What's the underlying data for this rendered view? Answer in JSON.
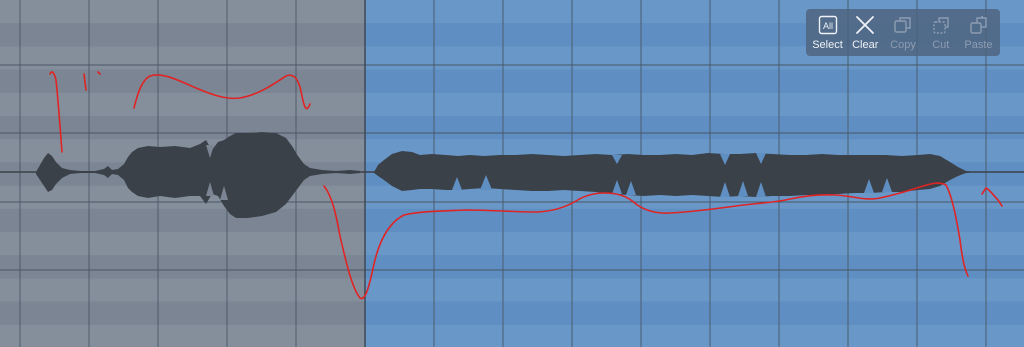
{
  "editor": {
    "colors": {
      "unselected_background": "#7b8593",
      "selected_background": "#5f8fc2",
      "grid_lines": "#3f4a57",
      "waveform": "#3b4148",
      "pitch_curve": "#e02424",
      "toolbar_background": "#4e637e"
    },
    "selection": {
      "state": "region after the first phrase is selected",
      "extends_to_end": true
    }
  },
  "toolbar": {
    "buttons": [
      {
        "id": "select-all",
        "label": "Select",
        "icon_text": "All",
        "icon": "select-all-icon",
        "enabled": true
      },
      {
        "id": "clear",
        "label": "Clear",
        "icon": "close-icon",
        "enabled": true
      },
      {
        "id": "copy",
        "label": "Copy",
        "icon": "copy-icon",
        "enabled": false
      },
      {
        "id": "cut",
        "label": "Cut",
        "icon": "cut-icon",
        "enabled": false
      },
      {
        "id": "paste",
        "label": "Paste",
        "icon": "paste-icon",
        "enabled": false
      }
    ]
  }
}
